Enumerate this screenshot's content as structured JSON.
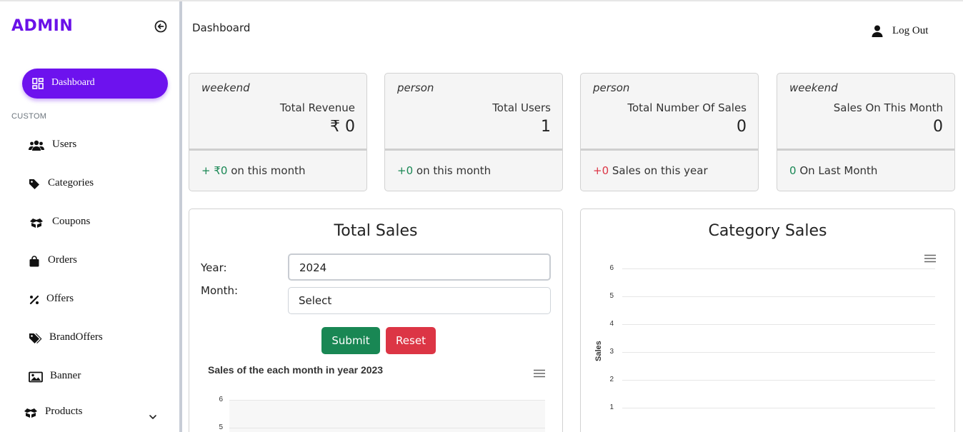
{
  "sidebar": {
    "brand": "ADMIN",
    "section_label": "CUSTOM",
    "active_item": {
      "label": "Dashboard",
      "icon": "dashboard-grid-icon"
    },
    "items": [
      {
        "label": "Users",
        "icon": "users-icon"
      },
      {
        "label": "Categories",
        "icon": "tag-icon"
      },
      {
        "label": "Coupons",
        "icon": "box-icon"
      },
      {
        "label": "Orders",
        "icon": "shopping-bag-icon"
      },
      {
        "label": "Offers",
        "icon": "percent-icon"
      },
      {
        "label": "BrandOffers",
        "icon": "tags-icon"
      },
      {
        "label": "Banner",
        "icon": "image-icon"
      },
      {
        "label": "Products",
        "icon": "box-icon"
      }
    ]
  },
  "header": {
    "title": "Dashboard",
    "logout_label": "Log Out"
  },
  "cards": [
    {
      "icon_text": "weekend",
      "category": "Total Revenue",
      "value": "₹ 0",
      "foot_value": "+ ₹0",
      "foot_text": " on this month",
      "foot_color": "#198754"
    },
    {
      "icon_text": "person",
      "category": "Total Users",
      "value": "1",
      "foot_value": "+0",
      "foot_text": " on this month",
      "foot_color": "#198754"
    },
    {
      "icon_text": "person",
      "category": "Total Number Of Sales",
      "value": "0",
      "foot_value": "+0",
      "foot_text": " Sales on this year",
      "foot_color": "#dc3545"
    },
    {
      "icon_text": "weekend",
      "category": "Sales On This Month",
      "value": "0",
      "foot_value": "0",
      "foot_text": " On Last Month",
      "foot_color": "#198754"
    }
  ],
  "total_sales": {
    "title": "Total Sales",
    "year_label": "Year:",
    "year_value": "2024",
    "month_label": "Month:",
    "month_value": "Select",
    "submit_label": "Submit",
    "reset_label": "Reset",
    "chart_title": "Sales of the each month in year 2023",
    "y_ticks": [
      "6",
      "5"
    ]
  },
  "category_sales": {
    "title": "Category Sales",
    "y_label": "Sales",
    "y_ticks": [
      "6",
      "5",
      "4",
      "3",
      "2",
      "1"
    ]
  },
  "colors": {
    "brand": "#6a11e8",
    "active_nav": "#6d12ee",
    "submit": "#198754",
    "reset": "#dc3545"
  }
}
